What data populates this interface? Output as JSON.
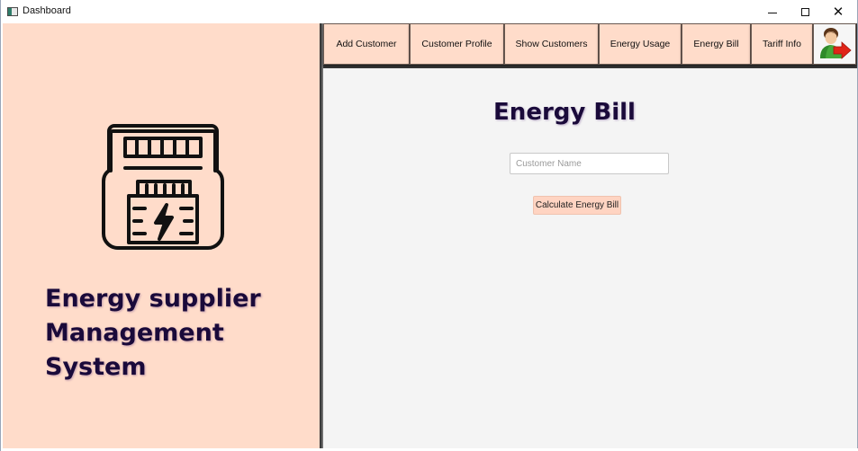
{
  "window": {
    "title": "Dashboard",
    "controls": {
      "minimize": "minimize",
      "maximize": "maximize",
      "close": "✕"
    }
  },
  "sidebar": {
    "icon": "electric-meter-icon",
    "system_title_lines": [
      "Energy supplier",
      "Management",
      "System"
    ]
  },
  "nav": {
    "items": [
      {
        "label": "Add Customer"
      },
      {
        "label": "Customer Profile"
      },
      {
        "label": "Show Customers"
      },
      {
        "label": "Energy Usage"
      },
      {
        "label": "Energy Bill"
      },
      {
        "label": "Tariff Info"
      }
    ],
    "logout_icon": "user-logout-icon"
  },
  "main": {
    "title": "Energy Bill",
    "customer_name_input": {
      "value": "",
      "placeholder": "Customer Name"
    },
    "calculate_button_label": "Calculate Energy Bill"
  },
  "colors": {
    "panel_peach": "#ffdcca",
    "title_navy": "#1a0a3a",
    "content_bg": "#f4f4f4",
    "button_peach": "#ffd4c2"
  }
}
